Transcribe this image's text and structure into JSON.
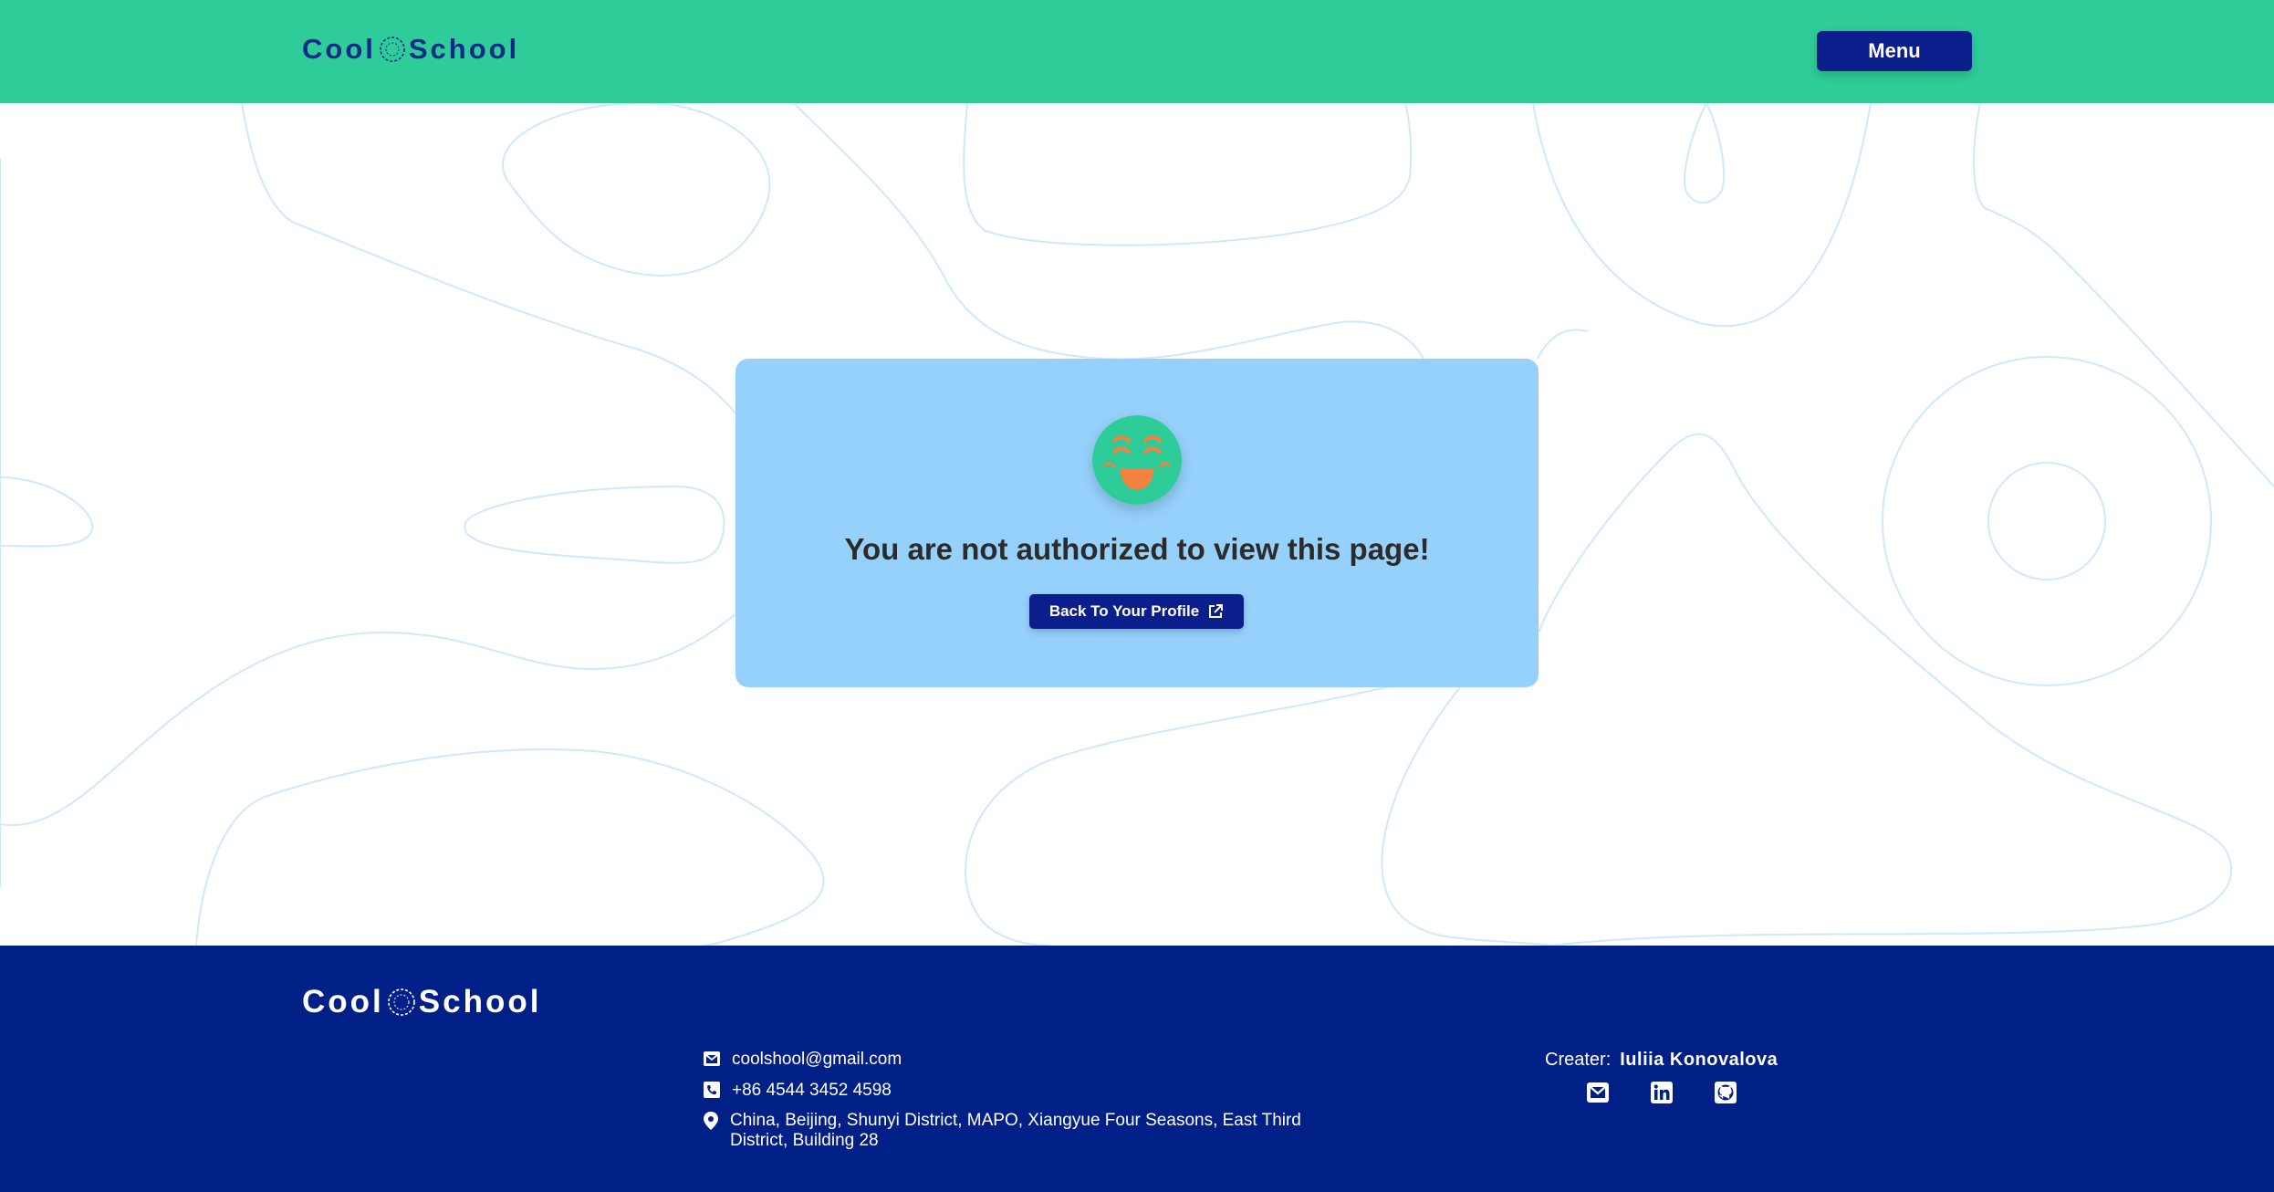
{
  "header": {
    "logo_left": "Cool",
    "logo_right": "School",
    "menu_label": "Menu"
  },
  "card": {
    "emoji_icon": "grinning-face-icon",
    "message": "You are not authorized to view this page!",
    "back_button_label": "Back To Your Profile",
    "back_button_icon": "external-link-icon"
  },
  "footer": {
    "logo_left": "Cool",
    "logo_right": "School",
    "email": "coolshool@gmail.com",
    "phone": "+86 4544 3452 4598",
    "address_line1": "China, Beijing, Shunyi District, MAPO, Xiangyue Four Seasons, East Third",
    "address_line2": "District, Building 28",
    "creator_label": "Creater:",
    "creator_name": "Iuliia Konovalova",
    "socials": [
      "envelope-icon",
      "linkedin-icon",
      "github-icon"
    ]
  },
  "colors": {
    "header_bg": "#2ecc99",
    "brand_blue": "#0a1f8c",
    "footer_bg": "#001f87",
    "card_bg": "#96d1fb",
    "emoji_face": "#2ecc99",
    "emoji_features": "#f4813f"
  }
}
